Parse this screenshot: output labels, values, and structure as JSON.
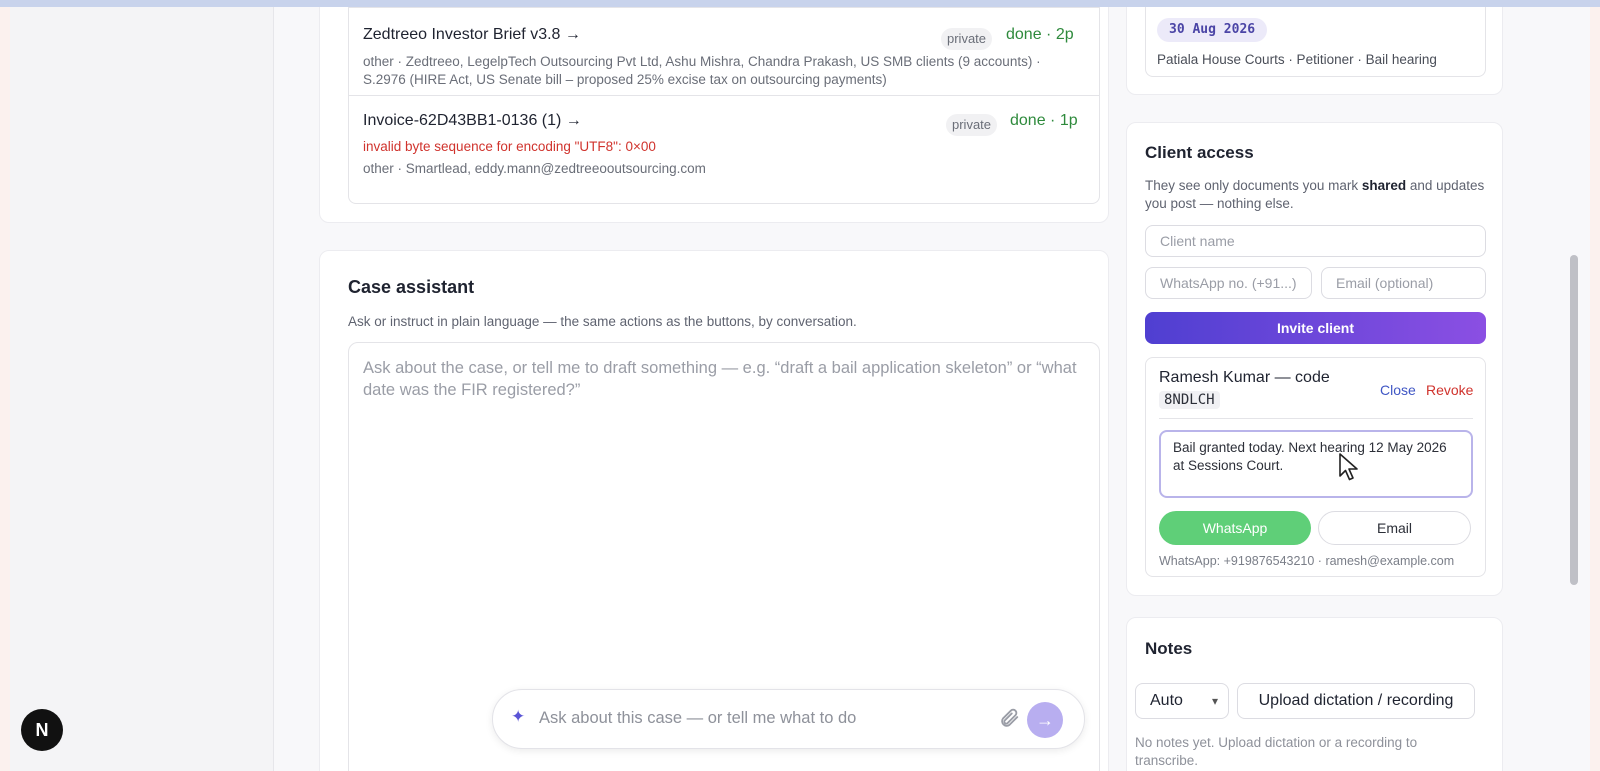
{
  "documents": [
    {
      "title": "Zedtreeo Investor Brief v3.8 →",
      "visibility": "private",
      "status": "done · 2p",
      "meta_line1": "other · Zedtreeo, LegelpTech Outsourcing Pvt Ltd, Ashu Mishra, Chandra Prakash, US SMB clients (9 accounts) ·",
      "meta_line2": "S.2976 (HIRE Act, US Senate bill – proposed 25% excise tax on outsourcing payments)"
    },
    {
      "title": "Invoice-62D43BB1-0136 (1) →",
      "visibility": "private",
      "status": "done · 1p",
      "error": "invalid byte sequence for encoding \"UTF8\": 0×00",
      "meta_line1": "other · Smartlead, eddy.mann@zedtreeooutsourcing.com"
    }
  ],
  "assistant": {
    "title": "Case assistant",
    "subtitle": "Ask or instruct in plain language — the same actions as the buttons, by conversation.",
    "textarea_placeholder": "Ask about the case, or tell me to draft something — e.g. “draft a bail application skeleton” or “what date was the FIR registered?”",
    "chat_placeholder": "Ask about this case — or tell me what to do",
    "sparkle_icon": "sparkle-icon",
    "attach_icon": "paperclip-icon",
    "send_icon": "arrow-right-icon",
    "send_glyph": "→"
  },
  "hearing": {
    "date": "30 Aug 2026",
    "details": "Patiala House Courts · Petitioner · Bail hearing"
  },
  "client_access": {
    "title": "Client access",
    "desc_prefix": "They see only documents you mark ",
    "desc_bold": "shared",
    "desc_suffix": " and updates you post — nothing else.",
    "client_name_placeholder": "Client name",
    "whatsapp_placeholder": "WhatsApp no. (+91...)",
    "email_placeholder": "Email (optional)",
    "invite_label": "Invite client",
    "client": {
      "name_prefix": "Ramesh Kumar — code",
      "code": "8NDLCH",
      "close_label": "Close",
      "revoke_label": "Revoke",
      "message": "Bail granted today. Next hearing 12 May 2026 at Sessions Court.",
      "whatsapp_label": "WhatsApp",
      "email_label": "Email",
      "contact": "WhatsApp: +919876543210 · ramesh@example.com"
    }
  },
  "notes": {
    "title": "Notes",
    "mode_value": "Auto",
    "upload_label": "Upload dictation / recording",
    "empty_text": "No notes yet. Upload dictation or a recording to transcribe."
  },
  "nextjs_badge": "N",
  "colors": {
    "accent": "#4f3fd1",
    "success": "#2e8a3c",
    "error": "#d0332d",
    "whatsapp": "#5fcf78"
  }
}
